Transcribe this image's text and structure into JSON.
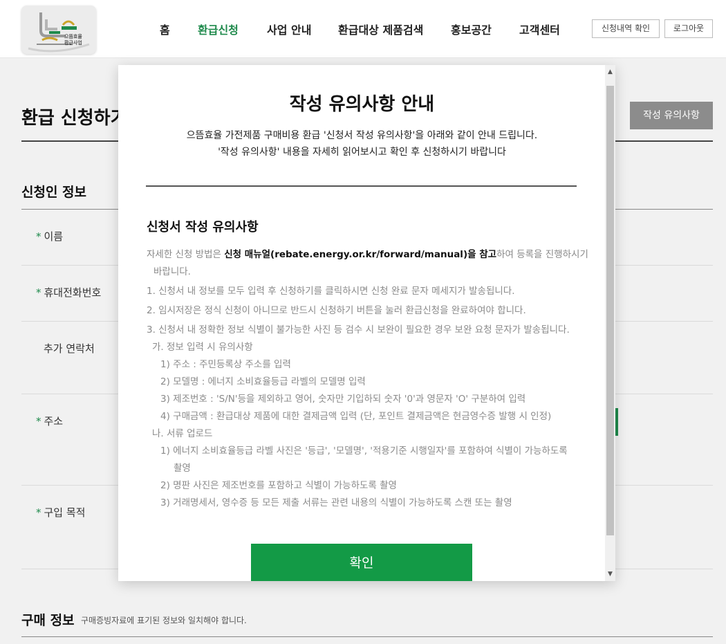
{
  "header": {
    "logo_text": [
      "으뜸효율",
      "환급사업"
    ],
    "nav": [
      "홈",
      "환급신청",
      "사업 안내",
      "환급대상 제품검색",
      "홍보공간",
      "고객센터"
    ],
    "active_nav": "환급신청",
    "util": [
      "신청내역 확인",
      "로그아웃"
    ]
  },
  "page": {
    "title": "환급 신청하기",
    "notice_button": "작성 유의사항",
    "applicant_section": "신청인 정보",
    "fields": [
      {
        "label": "이름",
        "required": true
      },
      {
        "label": "휴대전화번호",
        "required": true
      },
      {
        "label": "추가 연락처",
        "required": false
      },
      {
        "label": "주소",
        "required": true
      },
      {
        "label": "구입 목적",
        "required": true
      }
    ],
    "purchase_section": "구매 정보",
    "purchase_desc": "구매증빙자료에 표기된 정보와 일치해야 합니다."
  },
  "modal": {
    "title": "작성 유의사항 안내",
    "intro1": "으뜸효율 가전제품 구매비용 환급 '신청서 작성 유의사항'을 아래와 같이 안내 드립니다.",
    "intro2": "'작성 유의사항' 내용을 자세히 읽어보시고 확인 후 신청하시기 바랍니다",
    "sub_title": "신청서 작성 유의사항",
    "lead_pre": "자세한 신청 방법은 ",
    "lead_strong": "신청 매뉴얼(rebate.energy.or.kr/forward/manual)을 참고",
    "lead_post": "하여 등록을 진행하시기",
    "lead_cont": "바랍니다.",
    "items": [
      "1. 신청서 내 정보를 모두 입력 후 신청하기를 클릭하시면 신청 완료 문자 메세지가 발송됩니다.",
      "2. 임시저장은 정식 신청이 아니므로 반드시 신청하기 버튼을 눌러 환급신청을 완료하여야 합니다.",
      "3. 신청서 내 정확한 정보 식별이 불가능한 사진 등 검수 시 보완이 필요한 경우 보완 요청 문자가 발송됩니다.",
      "가. 정보 입력 시 유의사항",
      "1) 주소 : 주민등록상 주소를 입력",
      "2) 모델명 : 에너지 소비효율등급 라벨의 모델명 입력",
      "3) 제조번호 : 'S/N'등을 제외하고 영어, 숫자만 기입하되 숫자 '0'과 영문자 'O' 구분하여 입력",
      "4) 구매금액 : 환급대상 제품에 대한 결제금액 입력 (단, 포인트 결제금액은 현금영수증 발행 시 인정)",
      "나. 서류 업로드",
      "1) 에너지 소비효율등급 라벨 사진은 '등급', '모델명', '적용기준 시행일자'를 포함하여 식별이 가능하도록",
      "촬영",
      "2) 명판 사진은 제조번호를 포함하고 식별이 가능하도록 촬영",
      "3) 거래명세서, 영수증 등 모든 제출 서류는 관련 내용의 식별이 가능하도록 스캔 또는 촬영"
    ],
    "confirm": "확인"
  },
  "colors": {
    "accent": "#139a46",
    "nav_active": "#1f8a4c",
    "notice_btn": "#8c8c8c"
  }
}
